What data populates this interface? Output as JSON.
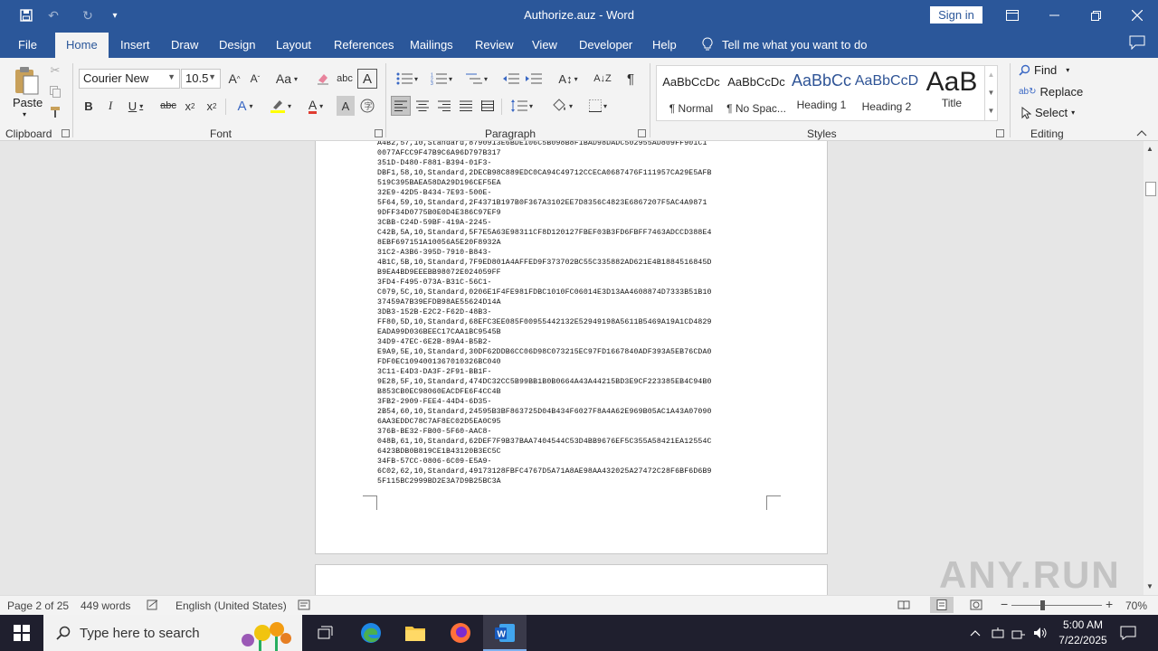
{
  "window": {
    "title": "Authorize.auz - Word",
    "sign_in": "Sign in"
  },
  "tabs": [
    "File",
    "Home",
    "Insert",
    "Draw",
    "Design",
    "Layout",
    "References",
    "Mailings",
    "Review",
    "View",
    "Developer",
    "Help"
  ],
  "active_tab": "Home",
  "tell_me": "Tell me what you want to do",
  "ribbon": {
    "clipboard": {
      "label": "Clipboard",
      "paste": "Paste"
    },
    "font": {
      "label": "Font",
      "font_name": "Courier New",
      "font_size": "10.5",
      "case_btn": "Aa"
    },
    "paragraph": {
      "label": "Paragraph"
    },
    "styles": {
      "label": "Styles",
      "items": [
        {
          "sample": "AaBbCcDc",
          "name": "¶ Normal"
        },
        {
          "sample": "AaBbCcDc",
          "name": "¶ No Spac..."
        },
        {
          "sample": "AaBbCc",
          "name": "Heading 1"
        },
        {
          "sample": "AaBbCcD",
          "name": "Heading 2"
        },
        {
          "sample": "AaB",
          "name": "Title"
        }
      ]
    },
    "editing": {
      "label": "Editing",
      "find": "Find",
      "replace": "Replace",
      "select": "Select"
    }
  },
  "document": {
    "text": "A4B2,57,10,Standard,8790913E6BDE106C5B098B8F1BAD98DADC502955AD809FF901C1\n0077AFCC9F47B9C6A96D797B317\n351D-D480-F881-B394-01F3-\nDBF1,58,10,Standard,2DECB98C889EDC0CA94C49712CCECA0687476F111957CA29E5AFB\n519C395BAEA58DA29D196CEF5EA\n32E9-42D5-B434-7E93-500E-\n5F64,59,10,Standard,2F4371B197B0F367A3102EE7D8356C4823E6867207F5AC4A9871\n9DFF34D0775B0E0D4E386C97EF9\n3CBB-C24D-59BF-419A-2245-\nC42B,5A,10,Standard,5F7E5A63E98311CF8D120127FBEF03B3FD6FBFF7463ADCCD388E4\n8EBF697151A10056A5E20F8932A\n31C2-A3B6-395D-7910-B843-\n4B1C,5B,10,Standard,7F9ED801A4AFFED9F373702BC55C335882AD621E4B1884516845D\nB9EA4BD9EEEBB98072E024059FF\n3FD4-F495-073A-B31C-56C1-\nC079,5C,10,Standard,0206E1F4FE981FDBC1010FC06014E3D13AA4608874D7333B51B10\n37459A7B39EFDB98AE55624D14A\n3DB3-152B-E2C2-F62D-48B3-\nFF80,5D,10,Standard,68EFC3EE085F00955442132E52949198A5611B5469A19A1CD4829\nEADA99D036BEEC17CAA1BC9545B\n34D9-47EC-6E2B-89A4-B5B2-\nE9A9,5E,10,Standard,30DF62DDB6CC06D98C073215EC97FD1667840ADF393A5EB76CDA0\nFDF0EC1094001367010326BC040\n3C11-E4D3-DA3F-2F91-BB1F-\n9E28,5F,10,Standard,474DC32CC5B99BB1B0B0664A43A44215BD3E9CF223385EB4C94B0\nB853CB0EC98060EACDFE6F4CC4B\n3FB2-2909-FEE4-44D4-6D35-\n2B54,60,10,Standard,24595B3BF863725D04B434F6027F8A4A62E969B05AC1A43A07090\n6AA3EDDC78C7AF8EC02D5EA0C95\n376B-BE32-FB00-5F60-AAC8-\n048B,61,10,Standard,62DEF7F9B37BAA7404544C53D4BB9676EF5C355A58421EA12554C\n6423BDB0B819CE1B43120B3EC5C\n34FB-57CC-0806-6C09-E5A9-\n6C02,62,10,Standard,49173128FBFC4767D5A71A8AE98AA432025A27472C28F6BF6D6B9\n5F115BC2999BD2E3A7D9B25BC3A"
  },
  "status": {
    "page": "Page 2 of 25",
    "words": "449 words",
    "language": "English (United States)",
    "zoom": "70%"
  },
  "taskbar": {
    "search_placeholder": "Type here to search",
    "time": "5:00 AM",
    "date": "7/22/2025"
  },
  "watermark": "ANY.RUN"
}
